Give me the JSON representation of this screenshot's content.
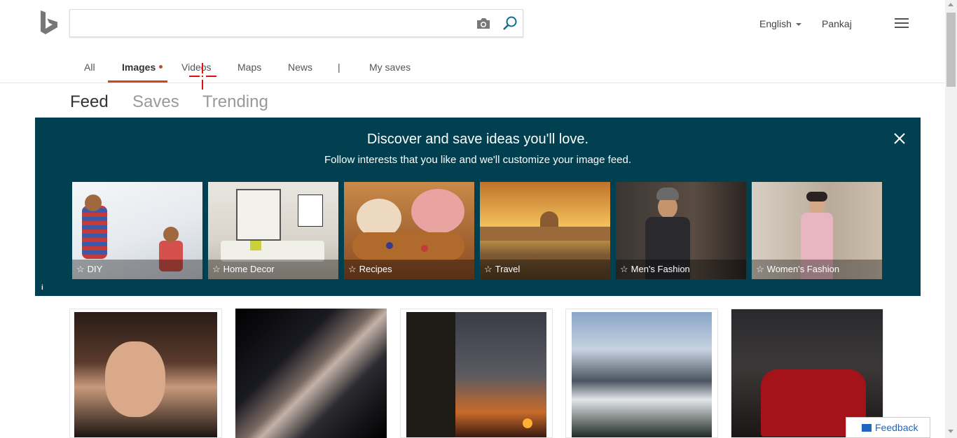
{
  "search": {
    "value": "",
    "placeholder": ""
  },
  "header": {
    "language": "English",
    "user": "Pankaj"
  },
  "scopes": [
    {
      "label": "All"
    },
    {
      "label": "Images"
    },
    {
      "label": "Videos"
    },
    {
      "label": "Maps"
    },
    {
      "label": "News"
    },
    {
      "label": "|"
    },
    {
      "label": "My saves"
    }
  ],
  "subtabs": [
    "Feed",
    "Saves",
    "Trending"
  ],
  "banner": {
    "title": "Discover and save ideas you'll love.",
    "subtitle": "Follow interests that you like and we'll customize your image feed.",
    "info": "i",
    "tiles": [
      {
        "label": "DIY"
      },
      {
        "label": "Home Decor"
      },
      {
        "label": "Recipes"
      },
      {
        "label": "Travel"
      },
      {
        "label": "Men's Fashion"
      },
      {
        "label": "Women's Fashion"
      }
    ]
  },
  "feedback": {
    "label": "Feedback"
  },
  "colors": {
    "banner": "#004050",
    "accent": "#c74b1e",
    "link": "#1f66c1"
  }
}
